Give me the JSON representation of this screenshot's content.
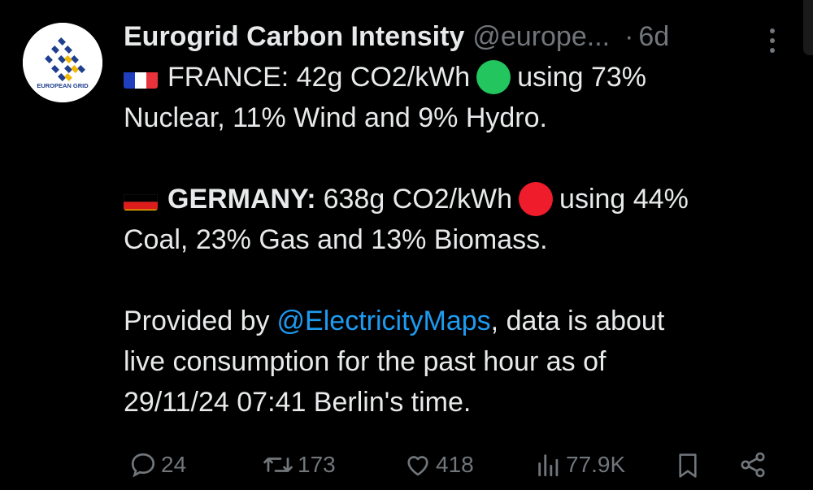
{
  "author": {
    "name": "Eurogrid Carbon Intensity",
    "handle": "@europe...",
    "separator": "·",
    "time": "6d",
    "avatar_text": "EUROPEAN GRID"
  },
  "tweet": {
    "france": {
      "flag": "france-flag",
      "line1": "FRANCE: 42g CO2/kWh",
      "status_color": "#22c55e",
      "line1_end": "using 73%",
      "line2": "Nuclear, 11% Wind and 9% Hydro."
    },
    "germany": {
      "flag": "germany-flag",
      "label": "GERMANY:",
      "line1_rest": "638g CO2/kWh",
      "status_color": "#ef1c2c",
      "line1_end": "using 44%",
      "line2": "Coal, 23% Gas and 13% Biomass."
    },
    "footer": {
      "prefix": "Provided by",
      "mention": "@ElectricityMaps",
      "suffix": ", data is about",
      "line2": "live consumption for the past hour as of",
      "line3": "29/11/24 07:41 Berlin's time."
    }
  },
  "actions": {
    "replies": "24",
    "reposts": "173",
    "likes": "418",
    "views": "77.9K"
  },
  "colors": {
    "background": "#000000",
    "text": "#e7e9ea",
    "muted": "#71767b",
    "link": "#1d9bf0"
  }
}
